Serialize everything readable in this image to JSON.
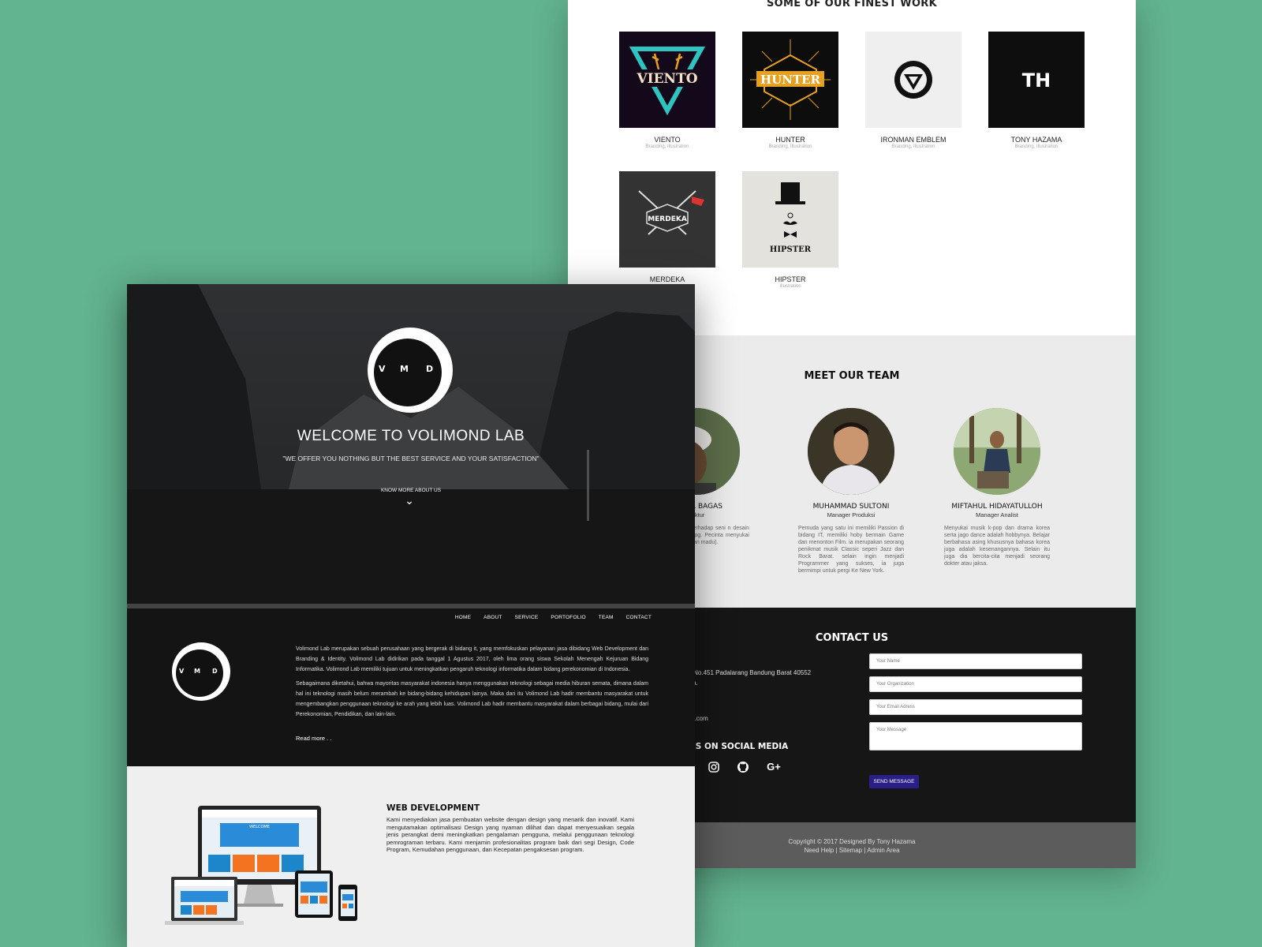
{
  "work": {
    "title": "SOME OF OUR FINEST WORK",
    "items": [
      {
        "name": "VIENTO",
        "tags": "Branding, Illustration",
        "logo_text": "VIENTO"
      },
      {
        "name": "HUNTER",
        "tags": "Branding, Illustration",
        "logo_text": "HUNTER"
      },
      {
        "name": "IRONMAN EMBLEM",
        "tags": "Branding, Illustration",
        "logo_text": ""
      },
      {
        "name": "TONY HAZAMA",
        "tags": "Branding, Illustration",
        "logo_text": "TH"
      },
      {
        "name": "MERDEKA",
        "tags": "",
        "logo_text": "MERDEKA"
      },
      {
        "name": "HIPSTER",
        "tags": "Illustration",
        "logo_text": "HIPSTER"
      }
    ]
  },
  "team": {
    "title": "MEET OUR TEAM",
    "members": [
      {
        "name": "ANDAR BAGAS",
        "role": "irektur",
        "bio": "uda yang memiliki terhadap seni n desain grafis serta e mmorpg. Pecinta menyukai makanan manisan dan madu)."
      },
      {
        "name": "MUHAMMAD SULTONI",
        "role": "Manager Produksi",
        "bio": "Pemuda yang satu ini memiliki Passion di bidang IT, memiliki hoby bermain Game dan menonton Film. ia merupakan seorang penikmat musik Classic seperi Jazz dan Rock Barat. selain ingin menjadi Programmer yang sukses, ia juga bermimpi untuk pergi Ke New York."
      },
      {
        "name": "MIFTAHUL HIDAYATULLOH",
        "role": "Manager Analist",
        "bio": "Menyukai musik k-pop dan drama korea serta jago dance adalah hobbynya. Belajar berbahasa asing khususnya bahasa korea juga adalah kesenangannya. Selain itu juga dia bercita-cita menjadi seorang dokter atau jaksa."
      }
    ]
  },
  "contact": {
    "title": "CONTACT US",
    "address_line1": "ng No.451 Padalarang Bandung Barat 40552",
    "address_line2": "esia.",
    "email": "nail.com",
    "social_title": "W US ON SOCIAL MEDIA",
    "social_icons": [
      "instagram-icon",
      "github-icon",
      "google-plus-icon"
    ],
    "google_plus_glyph": "G+",
    "form": {
      "name_placeholder": "Your Name",
      "org_placeholder": "Your Organization",
      "email_placeholder": "Your Email Adress",
      "message_placeholder": "Your Message",
      "send_label": "SEND MESSAGE"
    }
  },
  "footer": {
    "copyright": "Copyright © 2017 Designed By Tony Hazama",
    "links": "Need Help | Sitemap | Admin Area"
  },
  "hero": {
    "logo_letters": [
      "V",
      "M",
      "D"
    ],
    "title": "WELCOME TO VOLIMOND LAB",
    "subtitle": "\"WE OFFER YOU NOTHING BUT THE BEST SERVICE AND YOUR SATISFACTION\"",
    "know_more": "KNOW MORE ABOUT US",
    "chevron": "⌄"
  },
  "nav": {
    "items": [
      "HOME",
      "ABOUT",
      "SERVICE",
      "PORTOFOLIO",
      "TEAM",
      "CONTACT"
    ]
  },
  "about": {
    "p1": "Volimond Lab merupakan sebuah perusahaan yang bergerak di bidang it, yang memfokuskan pelayanan jasa dibidang Web Development dan Branding & Identity. Volimond Lab didirikan pada tanggal 1 Agustus 2017, oleh lima orang siswa Sekolah Menengah Kejuruan Bidang Informatika. Volimond Lab memiliki tujuan untuk meningkatkan pengaruh teknologi informatika dalam bidang perekonomian di Indonesia.",
    "p2": "Sebagaimana diketahui, bahwa mayoritas masyarakat indonesia hanya menggunakan teknologi sebagai media hiburan semata, dimana dalam hal ini teknologi masih belum merambah ke bidang-bidang kehidupan lainya. Maka dari itu Volimond Lab hadir membantu masyarakat untuk mengembangkan penggunaan teknologi ke arah yang lebih luas. Volimond Lab hadir membantu masyarakat dalam berbagai bidang, mulai dari Perekonomian, Pendidikan, dan lain-lain.",
    "read_more": "Read more . ."
  },
  "service": {
    "title": "WEB DEVELOPMENT",
    "text": "Kami menyediakan jasa pembuatan website dengan design yang menarik dan inovatif. Kami mengutamakan optimalisasi Design yang nyaman dilihat dan dapat menyesuaikan segala jenis perangkat demi meningkatkan pengalaman pengguna, melalui penggunaan teknologi pemrograman terbaru. Kami menjamin profesionalitas program baik dari segi Design, Code Program, Kemudahan penggunaan, dan Kecepatan pengaksesan program.",
    "mock_screen_text": "WELCOME"
  },
  "colors": {
    "background": "#62b38f",
    "dark": "#141414",
    "accent_button": "#2a1f86"
  }
}
